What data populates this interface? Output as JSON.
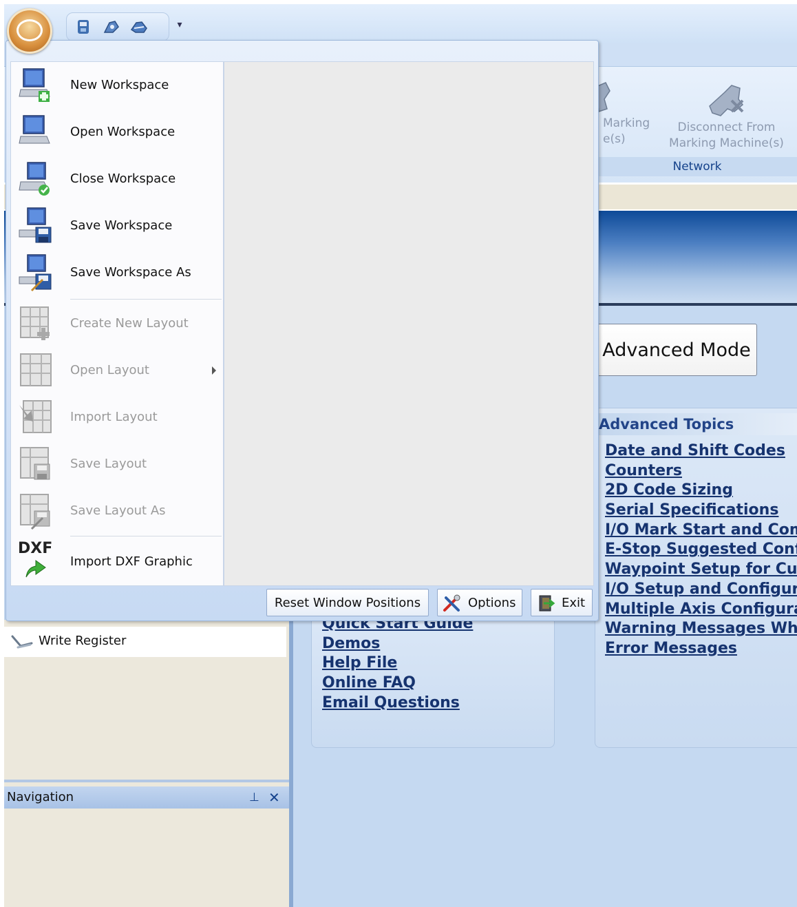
{
  "ribbon": {
    "marking_partial": "Marking\ne(s)",
    "disconnect_label": "Disconnect From\nMarking Machine(s)",
    "group_network": "Network"
  },
  "advanced_mode_button": "Advanced Mode",
  "advanced_topics": {
    "title": "Advanced Topics",
    "links": [
      "Date and Shift Codes",
      "Counters",
      "2D Code Sizing",
      "Serial Specifications",
      "I/O Mark Start and Comp",
      "E-Stop Suggested Config",
      "Waypoint Setup for Custo",
      "I/O Setup and Configurat",
      "Multiple Axis Configurati",
      "Warning Messages When",
      "Error Messages"
    ]
  },
  "help_links": [
    "Quick Start Guide",
    "Demos",
    "Help File",
    "Online FAQ",
    "Email Questions"
  ],
  "left_dock": {
    "write_register": "Write Register"
  },
  "navigation": {
    "title": "Navigation",
    "pin": "⊥",
    "close": "✕"
  },
  "app_menu": {
    "items": [
      {
        "label": "New Workspace",
        "icon": "new-workspace-icon",
        "enabled": true
      },
      {
        "label": "Open Workspace",
        "icon": "open-workspace-icon",
        "enabled": true
      },
      {
        "label": "Close Workspace",
        "icon": "close-workspace-icon",
        "enabled": true
      },
      {
        "label": "Save Workspace",
        "icon": "save-workspace-icon",
        "enabled": true
      },
      {
        "label": "Save Workspace As",
        "icon": "save-workspace-as-icon",
        "enabled": true
      },
      {
        "label": "Create New Layout",
        "icon": "create-layout-icon",
        "enabled": false
      },
      {
        "label": "Open Layout",
        "icon": "open-layout-icon",
        "enabled": false
      },
      {
        "label": "Import Layout",
        "icon": "import-layout-icon",
        "enabled": false
      },
      {
        "label": "Save Layout",
        "icon": "save-layout-icon",
        "enabled": false
      },
      {
        "label": "Save Layout As",
        "icon": "save-layout-as-icon",
        "enabled": false
      },
      {
        "label": "Import DXF Graphic",
        "icon": "dxf-icon",
        "enabled": true
      }
    ],
    "dxf_text": "DXF",
    "footer": {
      "reset": "Reset Window Positions",
      "options": "Options",
      "exit": "Exit"
    }
  }
}
